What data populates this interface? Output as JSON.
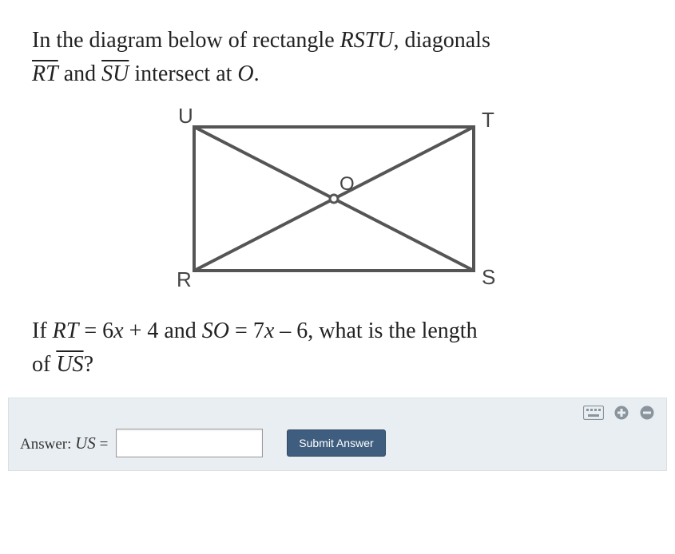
{
  "problem": {
    "line1_pre": "In the diagram below of rectangle ",
    "line1_rect": "RSTU",
    "line1_post": ", diagonals",
    "line2_seg1": "RT",
    "line2_mid": " and ",
    "line2_seg2": "SU",
    "line2_post": " intersect at ",
    "line2_ptO": "O",
    "line2_end": ".",
    "q_pre": "If ",
    "q_rt": "RT",
    "q_eq1": " = 6",
    "q_x1": "x",
    "q_mid1": " + 4 and ",
    "q_so": "SO",
    "q_eq2": " = 7",
    "q_x2": "x",
    "q_mid2": " – 6, what is the length",
    "q_of": "of ",
    "q_us": "US",
    "q_end": "?"
  },
  "diagram": {
    "U": "U",
    "T": "T",
    "R": "R",
    "S": "S",
    "O": "O"
  },
  "answer": {
    "label_pre": "Answer:  ",
    "label_var": "US",
    "label_eq": " =",
    "submit": "Submit Answer"
  },
  "chart_data": {
    "type": "diagram",
    "shape": "rectangle",
    "vertices": [
      "R",
      "S",
      "T",
      "U"
    ],
    "diagonals": [
      "RT",
      "SU"
    ],
    "intersection": "O",
    "given": {
      "RT": "6x + 4",
      "SO": "7x - 6"
    },
    "find": "US"
  }
}
